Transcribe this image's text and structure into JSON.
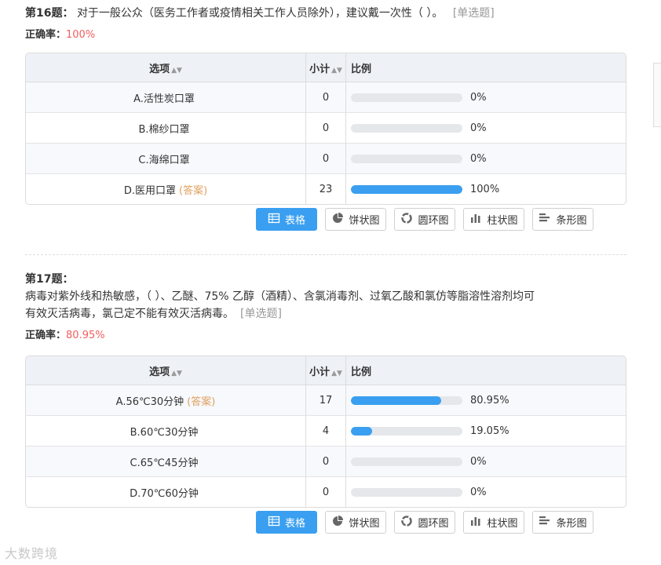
{
  "colors": {
    "accent": "#3a9ff0",
    "rate": "#f35e5e",
    "answer": "#e0a060"
  },
  "questions": [
    {
      "num": "第16题：",
      "text": "对于一般公众（医务工作者或疫情相关工作人员除外），建议戴一次性（ ）。",
      "tag": "[单选题]",
      "rate_label": "正确率：",
      "rate_value": "100%",
      "headers": {
        "option": "选项",
        "count": "小计",
        "ratio": "比例"
      },
      "rows": [
        {
          "label": "A.活性炭口罩",
          "answer": "",
          "count": "0",
          "percent": "0%",
          "value": 0
        },
        {
          "label": "B.棉纱口罩",
          "answer": "",
          "count": "0",
          "percent": "0%",
          "value": 0
        },
        {
          "label": "C.海绵口罩",
          "answer": "",
          "count": "0",
          "percent": "0%",
          "value": 0
        },
        {
          "label": "D.医用口罩",
          "answer": "(答案)",
          "count": "23",
          "percent": "100%",
          "value": 100
        }
      ]
    },
    {
      "num": "第17题：",
      "text_line1": "病毒对紫外线和热敏感，（ ）、乙醚、75% 乙醇（酒精）、含氯消毒剂、过氧乙酸和氯仿等脂溶性溶剂均可",
      "text_line2": "有效灭活病毒，氯己定不能有效灭活病毒。",
      "tag": "[单选题]",
      "rate_label": "正确率：",
      "rate_value": "80.95%",
      "headers": {
        "option": "选项",
        "count": "小计",
        "ratio": "比例"
      },
      "rows": [
        {
          "label": "A.56℃30分钟",
          "answer": "(答案)",
          "count": "17",
          "percent": "80.95%",
          "value": 80.95
        },
        {
          "label": "B.60℃30分钟",
          "answer": "",
          "count": "4",
          "percent": "19.05%",
          "value": 19.05
        },
        {
          "label": "C.65℃45分钟",
          "answer": "",
          "count": "0",
          "percent": "0%",
          "value": 0
        },
        {
          "label": "D.70℃60分钟",
          "answer": "",
          "count": "0",
          "percent": "0%",
          "value": 0
        }
      ]
    }
  ],
  "buttons": [
    {
      "label": "表格",
      "icon": "table-icon",
      "active": true
    },
    {
      "label": "饼状图",
      "icon": "pie-chart-icon",
      "active": false
    },
    {
      "label": "圆环图",
      "icon": "donut-chart-icon",
      "active": false
    },
    {
      "label": "柱状图",
      "icon": "bar-chart-icon",
      "active": false
    },
    {
      "label": "条形图",
      "icon": "horizontal-bar-icon",
      "active": false
    }
  ],
  "watermark": "大数跨境"
}
